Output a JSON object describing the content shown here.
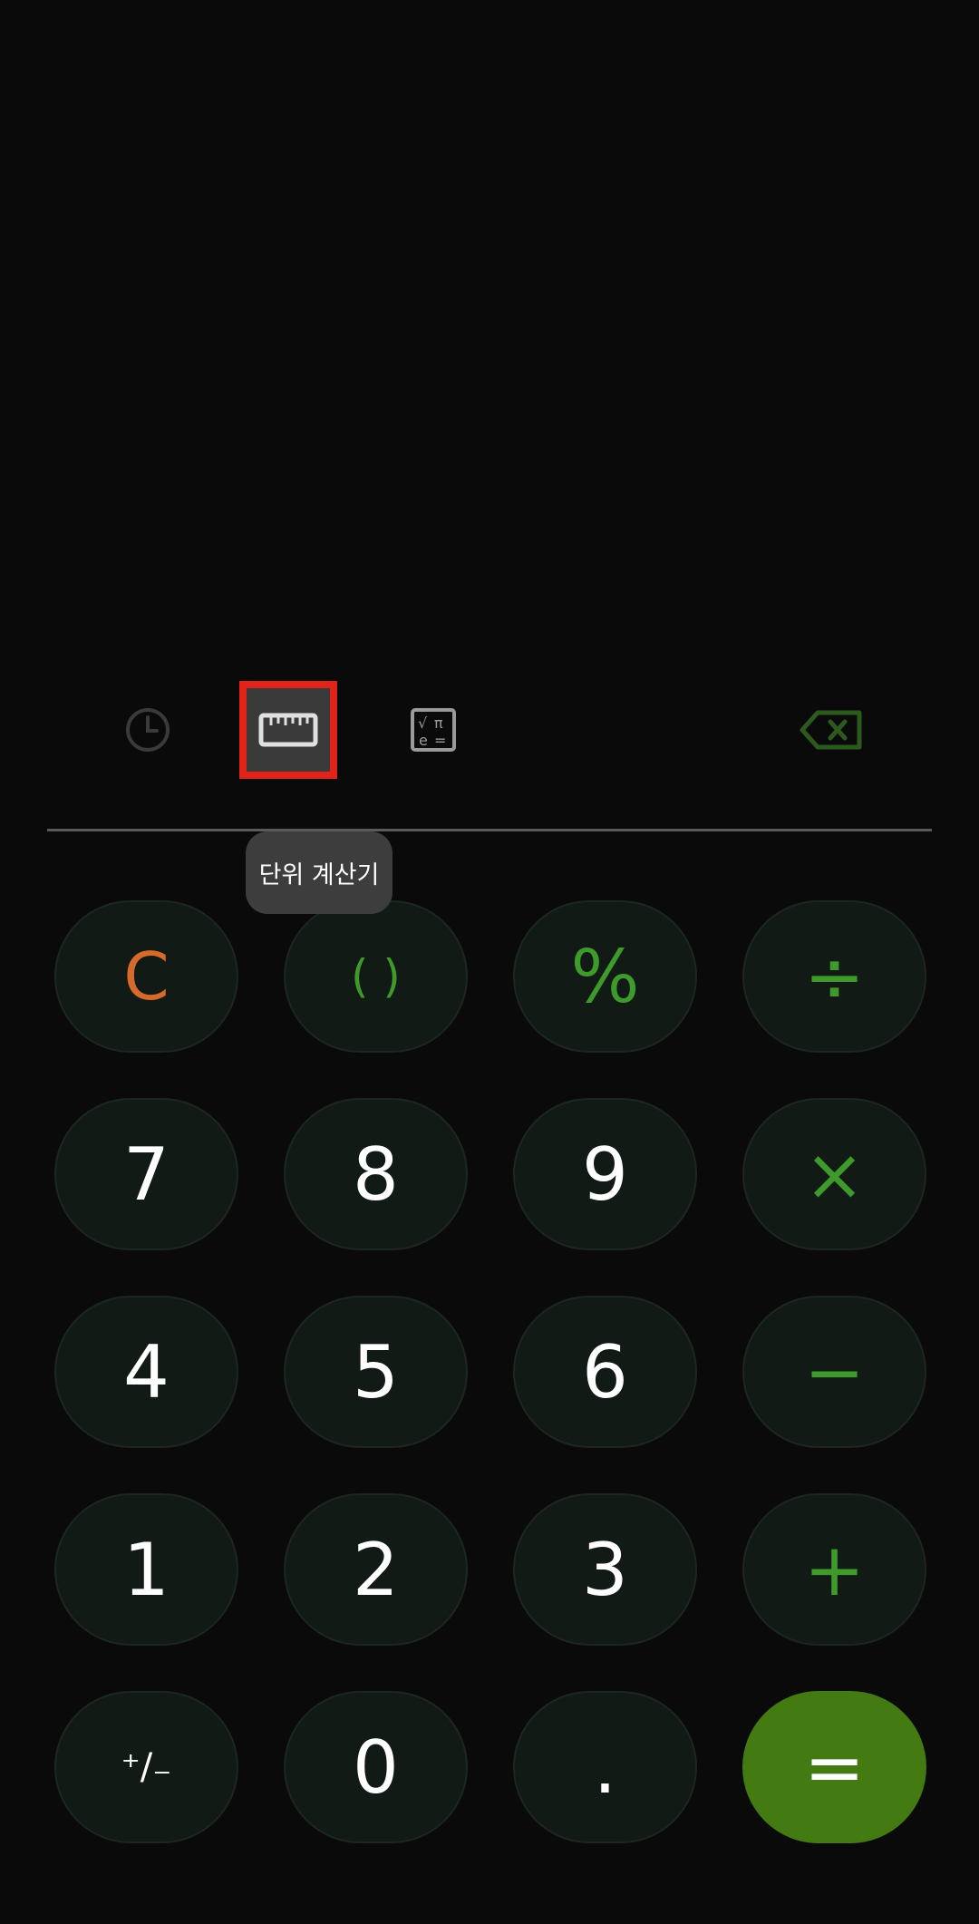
{
  "toolbar": {
    "history_icon": "clock-icon",
    "unit_icon": "ruler-icon",
    "scientific_icon": "scientific-icon",
    "backspace_icon": "backspace-icon",
    "selected_tool": "unit",
    "highlight_color": "#e2231a"
  },
  "tooltip": {
    "text": "단위 계산기"
  },
  "keypad": {
    "rows": [
      [
        {
          "label": "C",
          "kind": "clear"
        },
        {
          "label": "( )",
          "kind": "paren"
        },
        {
          "label": "%",
          "kind": "op"
        },
        {
          "label": "÷",
          "kind": "op"
        }
      ],
      [
        {
          "label": "7",
          "kind": "digit"
        },
        {
          "label": "8",
          "kind": "digit"
        },
        {
          "label": "9",
          "kind": "digit"
        },
        {
          "label": "×",
          "kind": "op"
        }
      ],
      [
        {
          "label": "4",
          "kind": "digit"
        },
        {
          "label": "5",
          "kind": "digit"
        },
        {
          "label": "6",
          "kind": "digit"
        },
        {
          "label": "−",
          "kind": "op"
        }
      ],
      [
        {
          "label": "1",
          "kind": "digit"
        },
        {
          "label": "2",
          "kind": "digit"
        },
        {
          "label": "3",
          "kind": "digit"
        },
        {
          "label": "+",
          "kind": "op"
        }
      ],
      [
        {
          "label": "⁺/₋",
          "kind": "small"
        },
        {
          "label": "0",
          "kind": "digit"
        },
        {
          "label": ".",
          "kind": "digit"
        },
        {
          "label": "=",
          "kind": "equals"
        }
      ]
    ]
  },
  "colors": {
    "background": "#0a0a0a",
    "key_background": "#121a16",
    "accent_green": "#3f9a2c",
    "clear_orange": "#d66a2a",
    "equals_green": "#437a12"
  }
}
